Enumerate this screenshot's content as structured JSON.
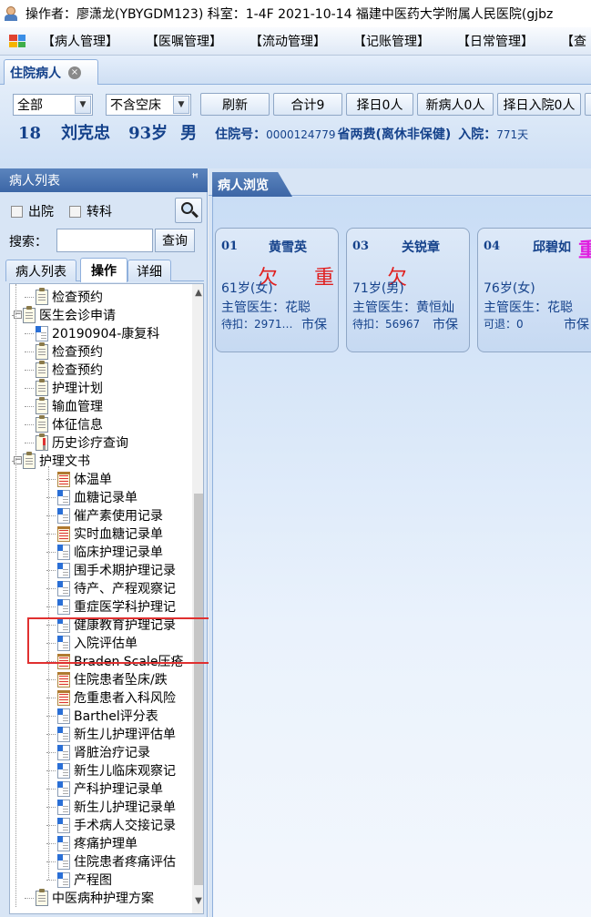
{
  "title": "操作者：廖潇龙(YBYGDM123) 科室：1-4F  2021-10-14  福建中医药大学附属人民医院(gjbz",
  "menu": [
    "【病人管理】",
    "【医嘱管理】",
    "【流动管理】",
    "【记账管理】",
    "【日常管理】",
    "【查"
  ],
  "main_tab": {
    "label": "住院病人",
    "close_icon": "×"
  },
  "toolbar": {
    "filter1": "全部",
    "filter2": "不含空床",
    "buttons": [
      "刷新",
      "合计9",
      "择日0人",
      "新病人0人",
      "择日入院0人"
    ]
  },
  "patient": {
    "bed": "18",
    "name": "刘克忠",
    "age": "93岁",
    "sex": "男",
    "admit_no_label": "住院号：",
    "admit_no": "0000124779",
    "category": "省两费(离休非保健)",
    "admit_label": "入院：",
    "admit_days": "771天"
  },
  "left_panel": {
    "header": "病人列表",
    "pin_icon": "ꟸ",
    "check_discharged": "出院",
    "check_transfer": "转科",
    "search_label": "搜索：",
    "search_value": "",
    "search_button": "查询",
    "subtabs": [
      "病人列表",
      "操作",
      "详细"
    ],
    "tree": [
      "检查预约",
      "医生会诊申请",
      "20190904-康复科",
      "检查预约",
      "检查预约",
      "护理计划",
      "输血管理",
      "体征信息",
      "历史诊疗查询",
      "护理文书",
      "体温单",
      "血糖记录单",
      "催产素使用记录",
      "实时血糖记录单",
      "临床护理记录单",
      "围手术期护理记录",
      "待产、产程观察记",
      "重症医学科护理记",
      "健康教育护理记录",
      "入院评估单",
      "Braden Scale压疮",
      "住院患者坠床/跌",
      "危重患者入科风险",
      "Barthel评分表",
      "新生儿护理评估单",
      "肾脏治疗记录",
      "新生儿临床观察记",
      "产科护理记录单",
      "新生儿护理记录单",
      "手术病人交接记录",
      "疼痛护理单",
      "住院患者疼痛评估",
      "产程图",
      "中医病种护理方案"
    ]
  },
  "right_panel": {
    "tab": "病人浏览",
    "cards": [
      {
        "bed": "01",
        "name": "黄雪英",
        "tags": [
          "欠",
          "重"
        ],
        "age": "61岁(女)",
        "doctor": "主管医生：花聪",
        "pay": "待扣：2971…",
        "insurance": "市保"
      },
      {
        "bed": "03",
        "name": "关锐章",
        "tags": [
          "欠"
        ],
        "age": "71岁(男)",
        "doctor": "主管医生：黄恒灿",
        "pay": "待扣：56967",
        "insurance": "市保"
      },
      {
        "bed": "04",
        "name": "邱碧如",
        "tags": [
          "重"
        ],
        "age": "76岁(女)",
        "doctor": "主管医生：花聪",
        "pay": "可退：0",
        "insurance": "市保"
      }
    ]
  },
  "colors": {
    "accent": "#15428b",
    "warning_red": "#e02020",
    "highlight_box": "#e03030",
    "magenta_tag": "#e020e0"
  }
}
